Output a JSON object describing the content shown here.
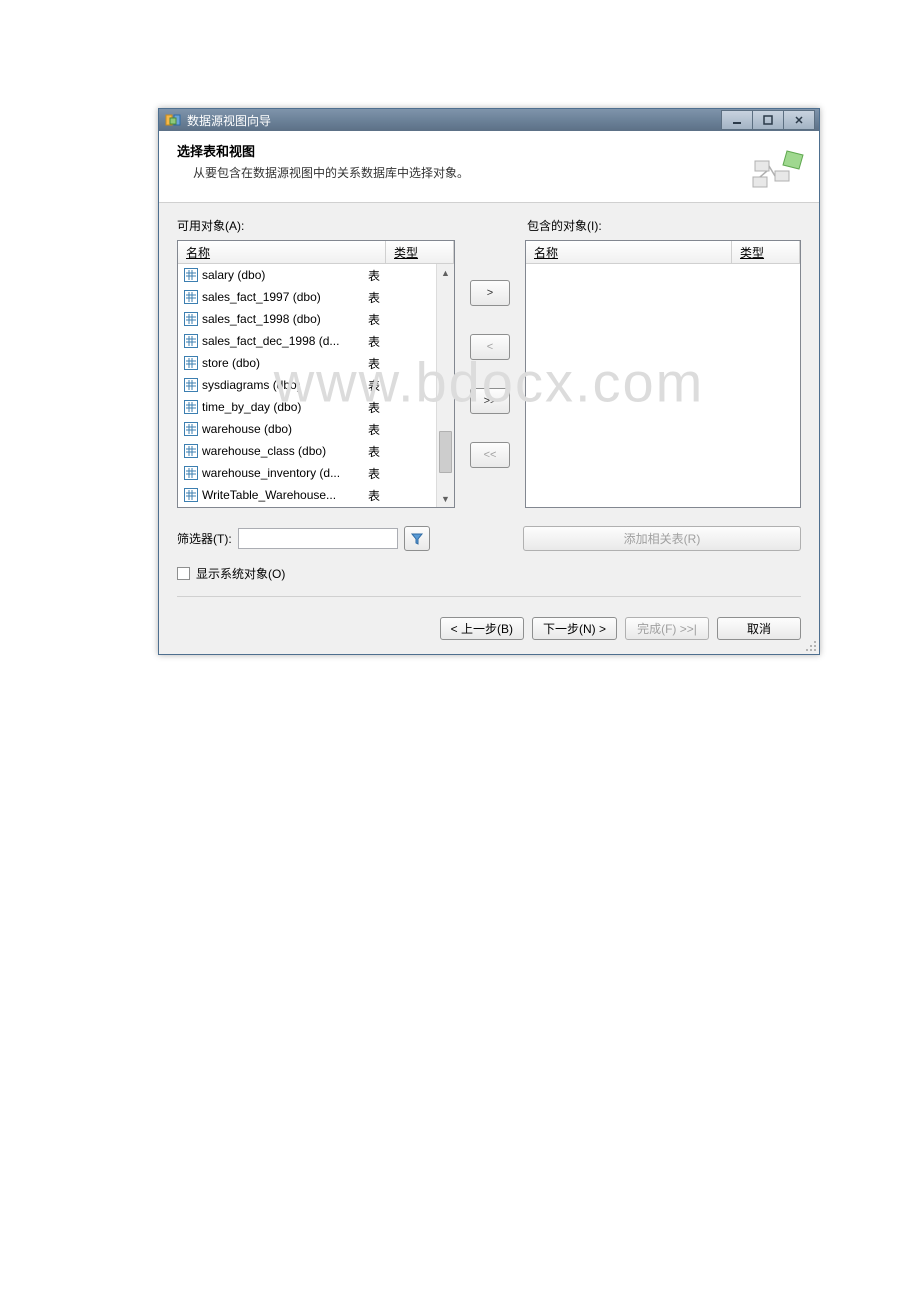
{
  "window": {
    "title": "数据源视图向导"
  },
  "header": {
    "title": "选择表和视图",
    "subtitle": "从要包含在数据源视图中的关系数据库中选择对象。"
  },
  "labels": {
    "available": "可用对象(A):",
    "included": "包含的对象(I):"
  },
  "columns": {
    "name": "名称",
    "type": "类型"
  },
  "available_items": [
    {
      "name": "salary (dbo)",
      "type": "表"
    },
    {
      "name": "sales_fact_1997 (dbo)",
      "type": "表"
    },
    {
      "name": "sales_fact_1998 (dbo)",
      "type": "表"
    },
    {
      "name": "sales_fact_dec_1998 (d...",
      "type": "表"
    },
    {
      "name": "store (dbo)",
      "type": "表"
    },
    {
      "name": "sysdiagrams (dbo)",
      "type": "表"
    },
    {
      "name": "time_by_day (dbo)",
      "type": "表"
    },
    {
      "name": "warehouse (dbo)",
      "type": "表"
    },
    {
      "name": "warehouse_class (dbo)",
      "type": "表"
    },
    {
      "name": "warehouse_inventory (d...",
      "type": "表"
    },
    {
      "name": "WriteTable_Warehouse...",
      "type": "表"
    }
  ],
  "move_buttons": {
    "add": ">",
    "remove": "<",
    "add_all": ">>",
    "remove_all": "<<"
  },
  "filter": {
    "label": "筛选器(T):",
    "value": ""
  },
  "add_related": "添加相关表(R)",
  "show_system": "显示系统对象(O)",
  "nav": {
    "back": "< 上一步(B)",
    "next": "下一步(N) >",
    "finish": "完成(F) >>|",
    "cancel": "取消"
  },
  "watermark": "www.bdocx.com"
}
